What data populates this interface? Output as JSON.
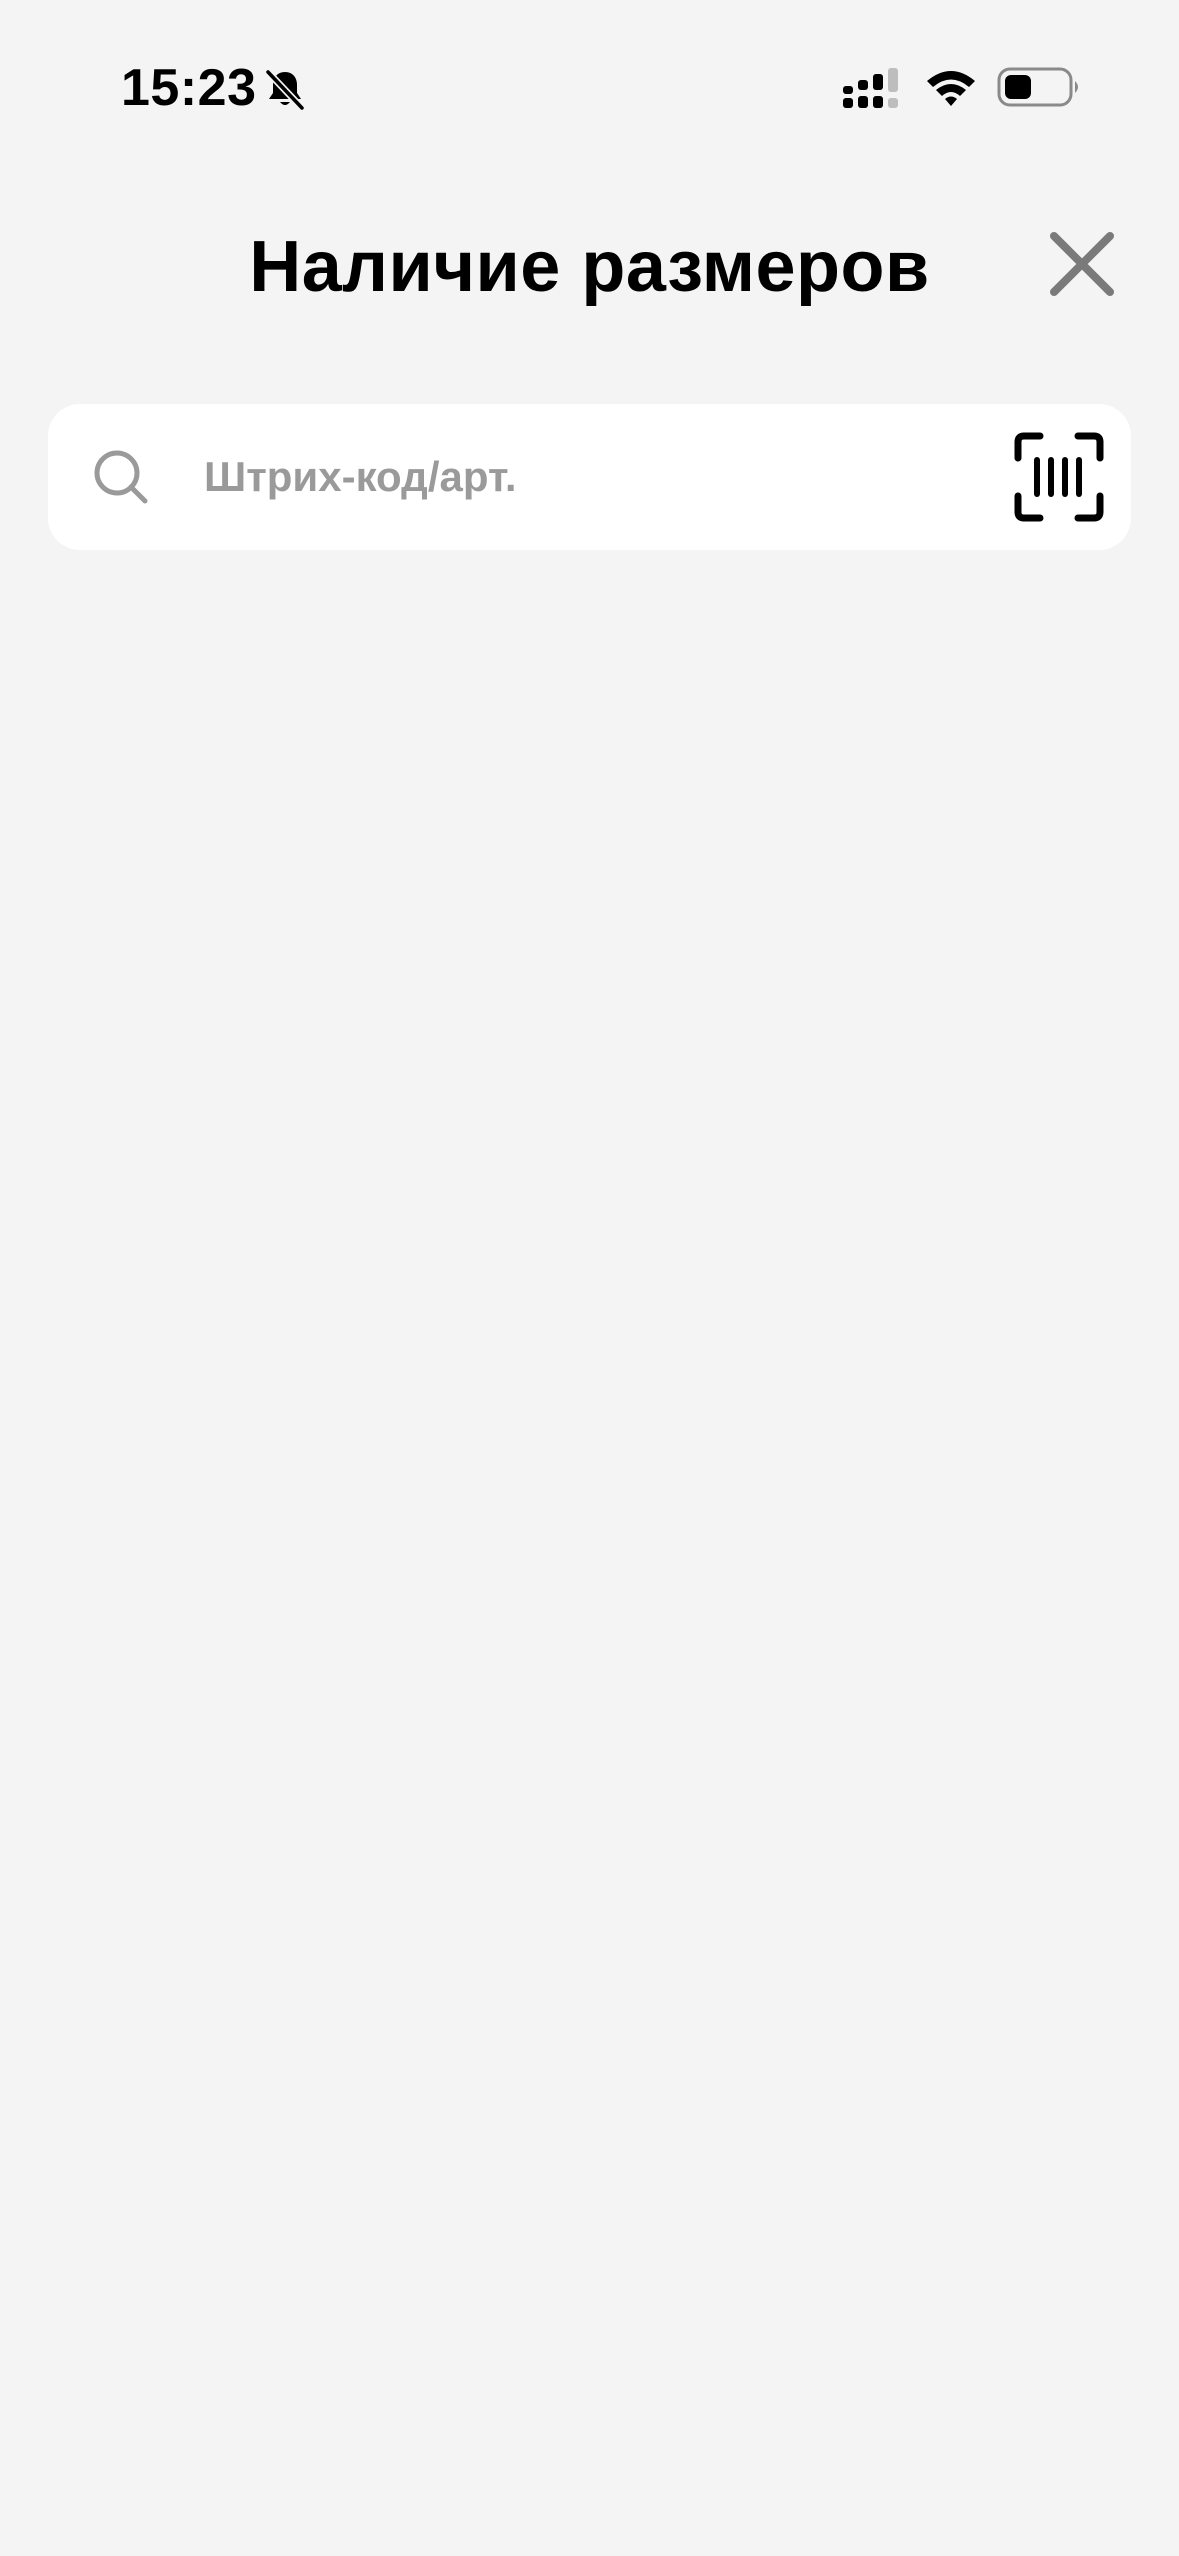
{
  "status_bar": {
    "time": "15:23",
    "icons": [
      "bell-slash-icon",
      "cellular-signal-icon",
      "wifi-icon",
      "battery-icon"
    ]
  },
  "header": {
    "title": "Наличие размеров",
    "close_icon": "close-icon"
  },
  "search": {
    "value": "",
    "placeholder": "Штрих-код/арт.",
    "search_icon": "search-icon",
    "scan_icon": "barcode-scan-icon"
  },
  "colors": {
    "background": "#f4f4f4",
    "surface": "#ffffff",
    "placeholder": "#9a9a9a",
    "close_icon": "#7a7a7a"
  }
}
